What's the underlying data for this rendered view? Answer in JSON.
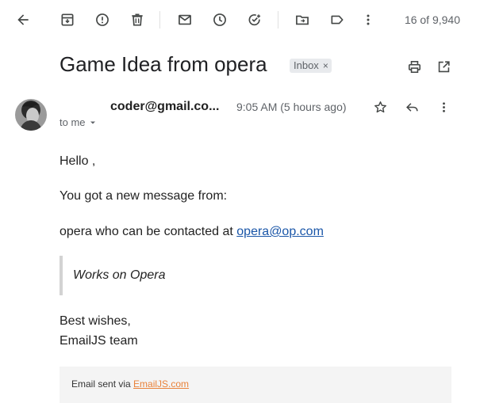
{
  "toolbar": {
    "counter": "16 of 9,940"
  },
  "email": {
    "subject": "Game Idea from opera",
    "label": "Inbox",
    "label_remove": "×",
    "sender": "coder@gmail.co...",
    "time": "9:05 AM (5 hours ago)",
    "recipient": "to me"
  },
  "body": {
    "greeting": "Hello ,",
    "line1": "You got a new message from:",
    "contact_prefix": "opera who can be contacted at ",
    "contact_email": "opera@op.com",
    "quote": "Works on Opera",
    "signoff1": "Best wishes,",
    "signoff2": "EmailJS team"
  },
  "footer": {
    "prefix": "Email sent via ",
    "link": "EmailJS.com"
  },
  "colors": {
    "link": "#1a56a8",
    "footer_link": "#e9823a",
    "chip_bg": "#e8eaed"
  }
}
